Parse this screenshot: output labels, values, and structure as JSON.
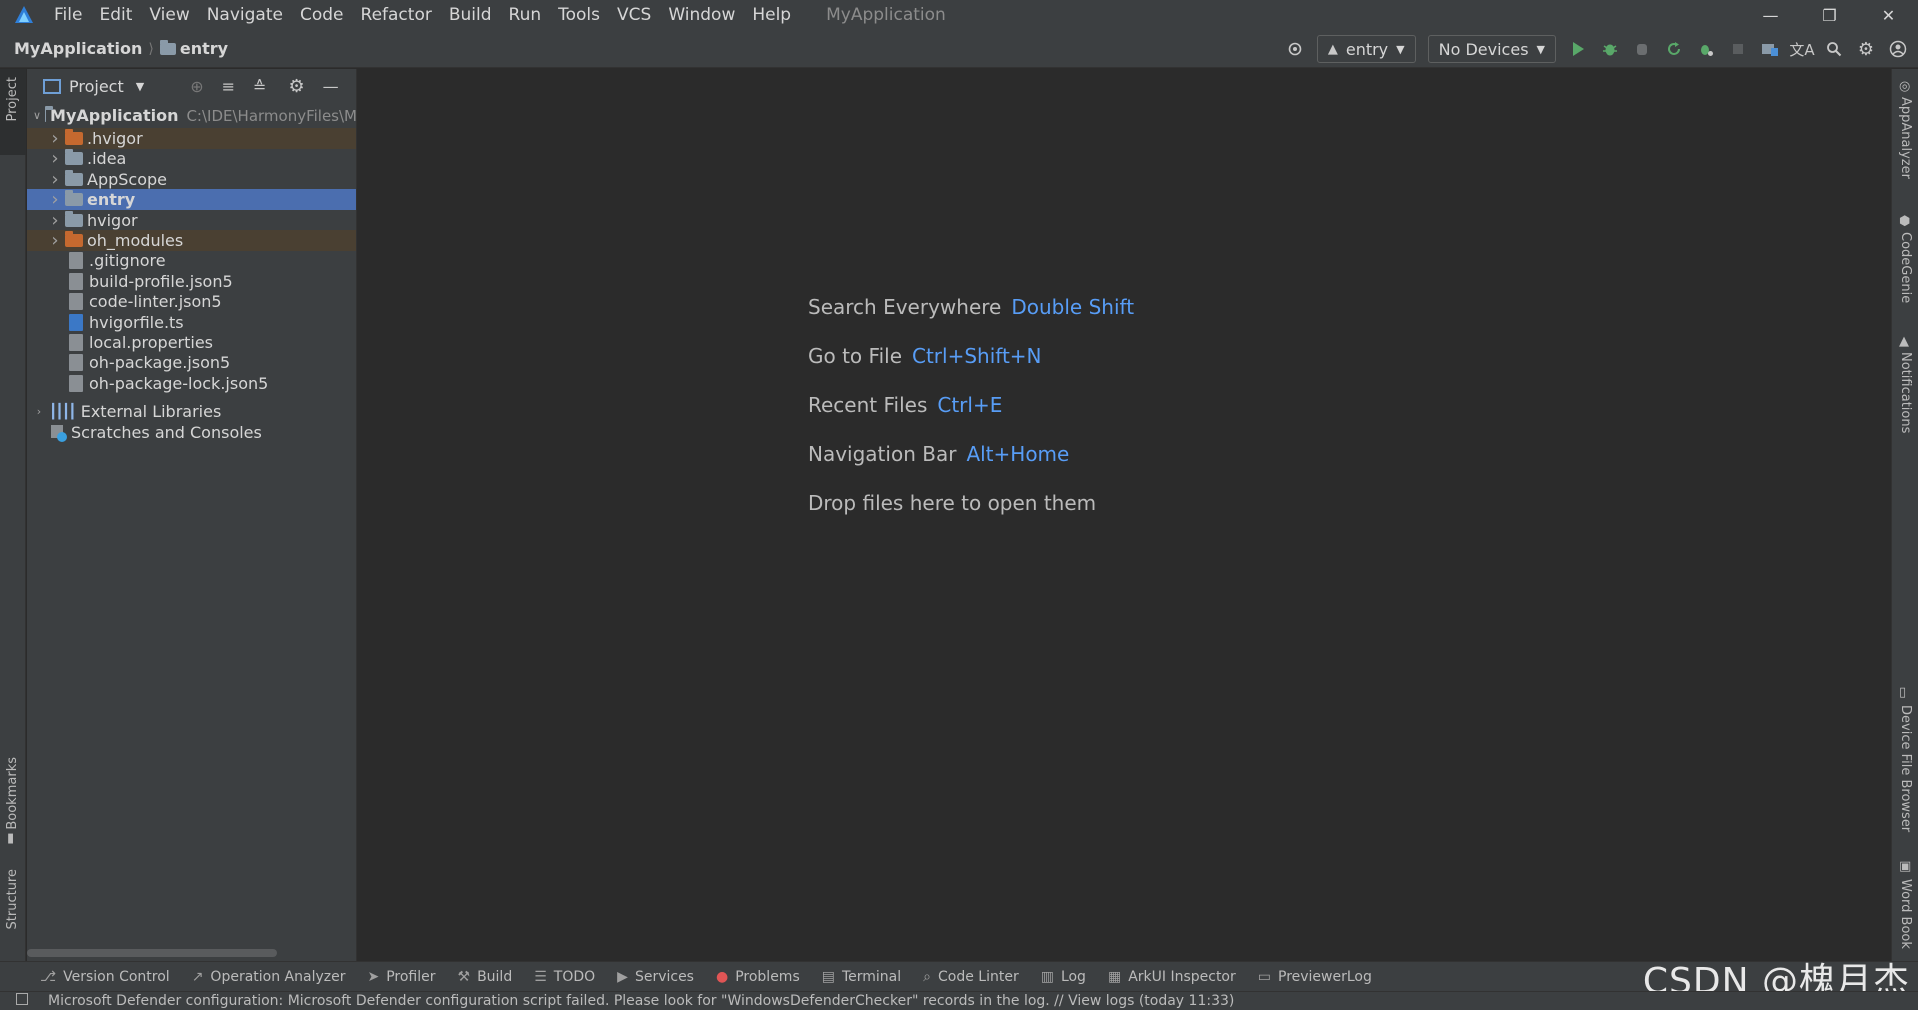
{
  "menubar": {
    "items": [
      "File",
      "Edit",
      "View",
      "Navigate",
      "Code",
      "Refactor",
      "Build",
      "Run",
      "Tools",
      "VCS",
      "Window",
      "Help"
    ],
    "window_title": "MyApplication"
  },
  "navbar": {
    "breadcrumb_project": "MyApplication",
    "breadcrumb_module": "entry"
  },
  "toolbar": {
    "config_selected": "entry",
    "device_selected": "No Devices"
  },
  "left_strip": {
    "project_label": "Project",
    "bookmarks_label": "Bookmarks",
    "structure_label": "Structure"
  },
  "right_strip": {
    "labels": [
      "AppAnalyzer",
      "CodeGenie",
      "Notifications",
      "Device File Browser",
      "Word Book"
    ]
  },
  "project_panel": {
    "title": "Project",
    "root_name": "MyApplication",
    "root_path": "C:\\IDE\\HarmonyFiles\\M",
    "items": [
      {
        "name": ".hvigor",
        "kind": "folder-orange",
        "highlight": "brown"
      },
      {
        "name": ".idea",
        "kind": "folder",
        "highlight": ""
      },
      {
        "name": "AppScope",
        "kind": "folder",
        "highlight": ""
      },
      {
        "name": "entry",
        "kind": "folder-module",
        "highlight": "selected"
      },
      {
        "name": "hvigor",
        "kind": "folder",
        "highlight": ""
      },
      {
        "name": "oh_modules",
        "kind": "folder-orange",
        "highlight": "brown"
      },
      {
        "name": ".gitignore",
        "kind": "file",
        "highlight": ""
      },
      {
        "name": "build-profile.json5",
        "kind": "file",
        "highlight": ""
      },
      {
        "name": "code-linter.json5",
        "kind": "file",
        "highlight": ""
      },
      {
        "name": "hvigorfile.ts",
        "kind": "file-ts",
        "highlight": ""
      },
      {
        "name": "local.properties",
        "kind": "file",
        "highlight": ""
      },
      {
        "name": "oh-package.json5",
        "kind": "file",
        "highlight": ""
      },
      {
        "name": "oh-package-lock.json5",
        "kind": "file",
        "highlight": ""
      }
    ],
    "external_libraries": "External Libraries",
    "scratches": "Scratches and Consoles"
  },
  "editor_hints": [
    {
      "label": "Search Everywhere",
      "key": "Double Shift"
    },
    {
      "label": "Go to File",
      "key": "Ctrl+Shift+N"
    },
    {
      "label": "Recent Files",
      "key": "Ctrl+E"
    },
    {
      "label": "Navigation Bar",
      "key": "Alt+Home"
    },
    {
      "label": "Drop files here to open them",
      "key": ""
    }
  ],
  "bottom_tabs": [
    "Version Control",
    "Operation Analyzer",
    "Profiler",
    "Build",
    "TODO",
    "Services",
    "Problems",
    "Terminal",
    "Code Linter",
    "Log",
    "ArkUI Inspector",
    "PreviewerLog"
  ],
  "status": {
    "message": "Microsoft Defender configuration: Microsoft Defender configuration script failed. Please look for \"WindowsDefenderChecker\" records in the log. // View logs (today 11:33)"
  },
  "watermark": "CSDN @槐月杰",
  "colors": {
    "accent": "#589df6",
    "selection": "#4b6eaf",
    "run_green": "#59a869",
    "folder_orange": "#c5692f"
  }
}
